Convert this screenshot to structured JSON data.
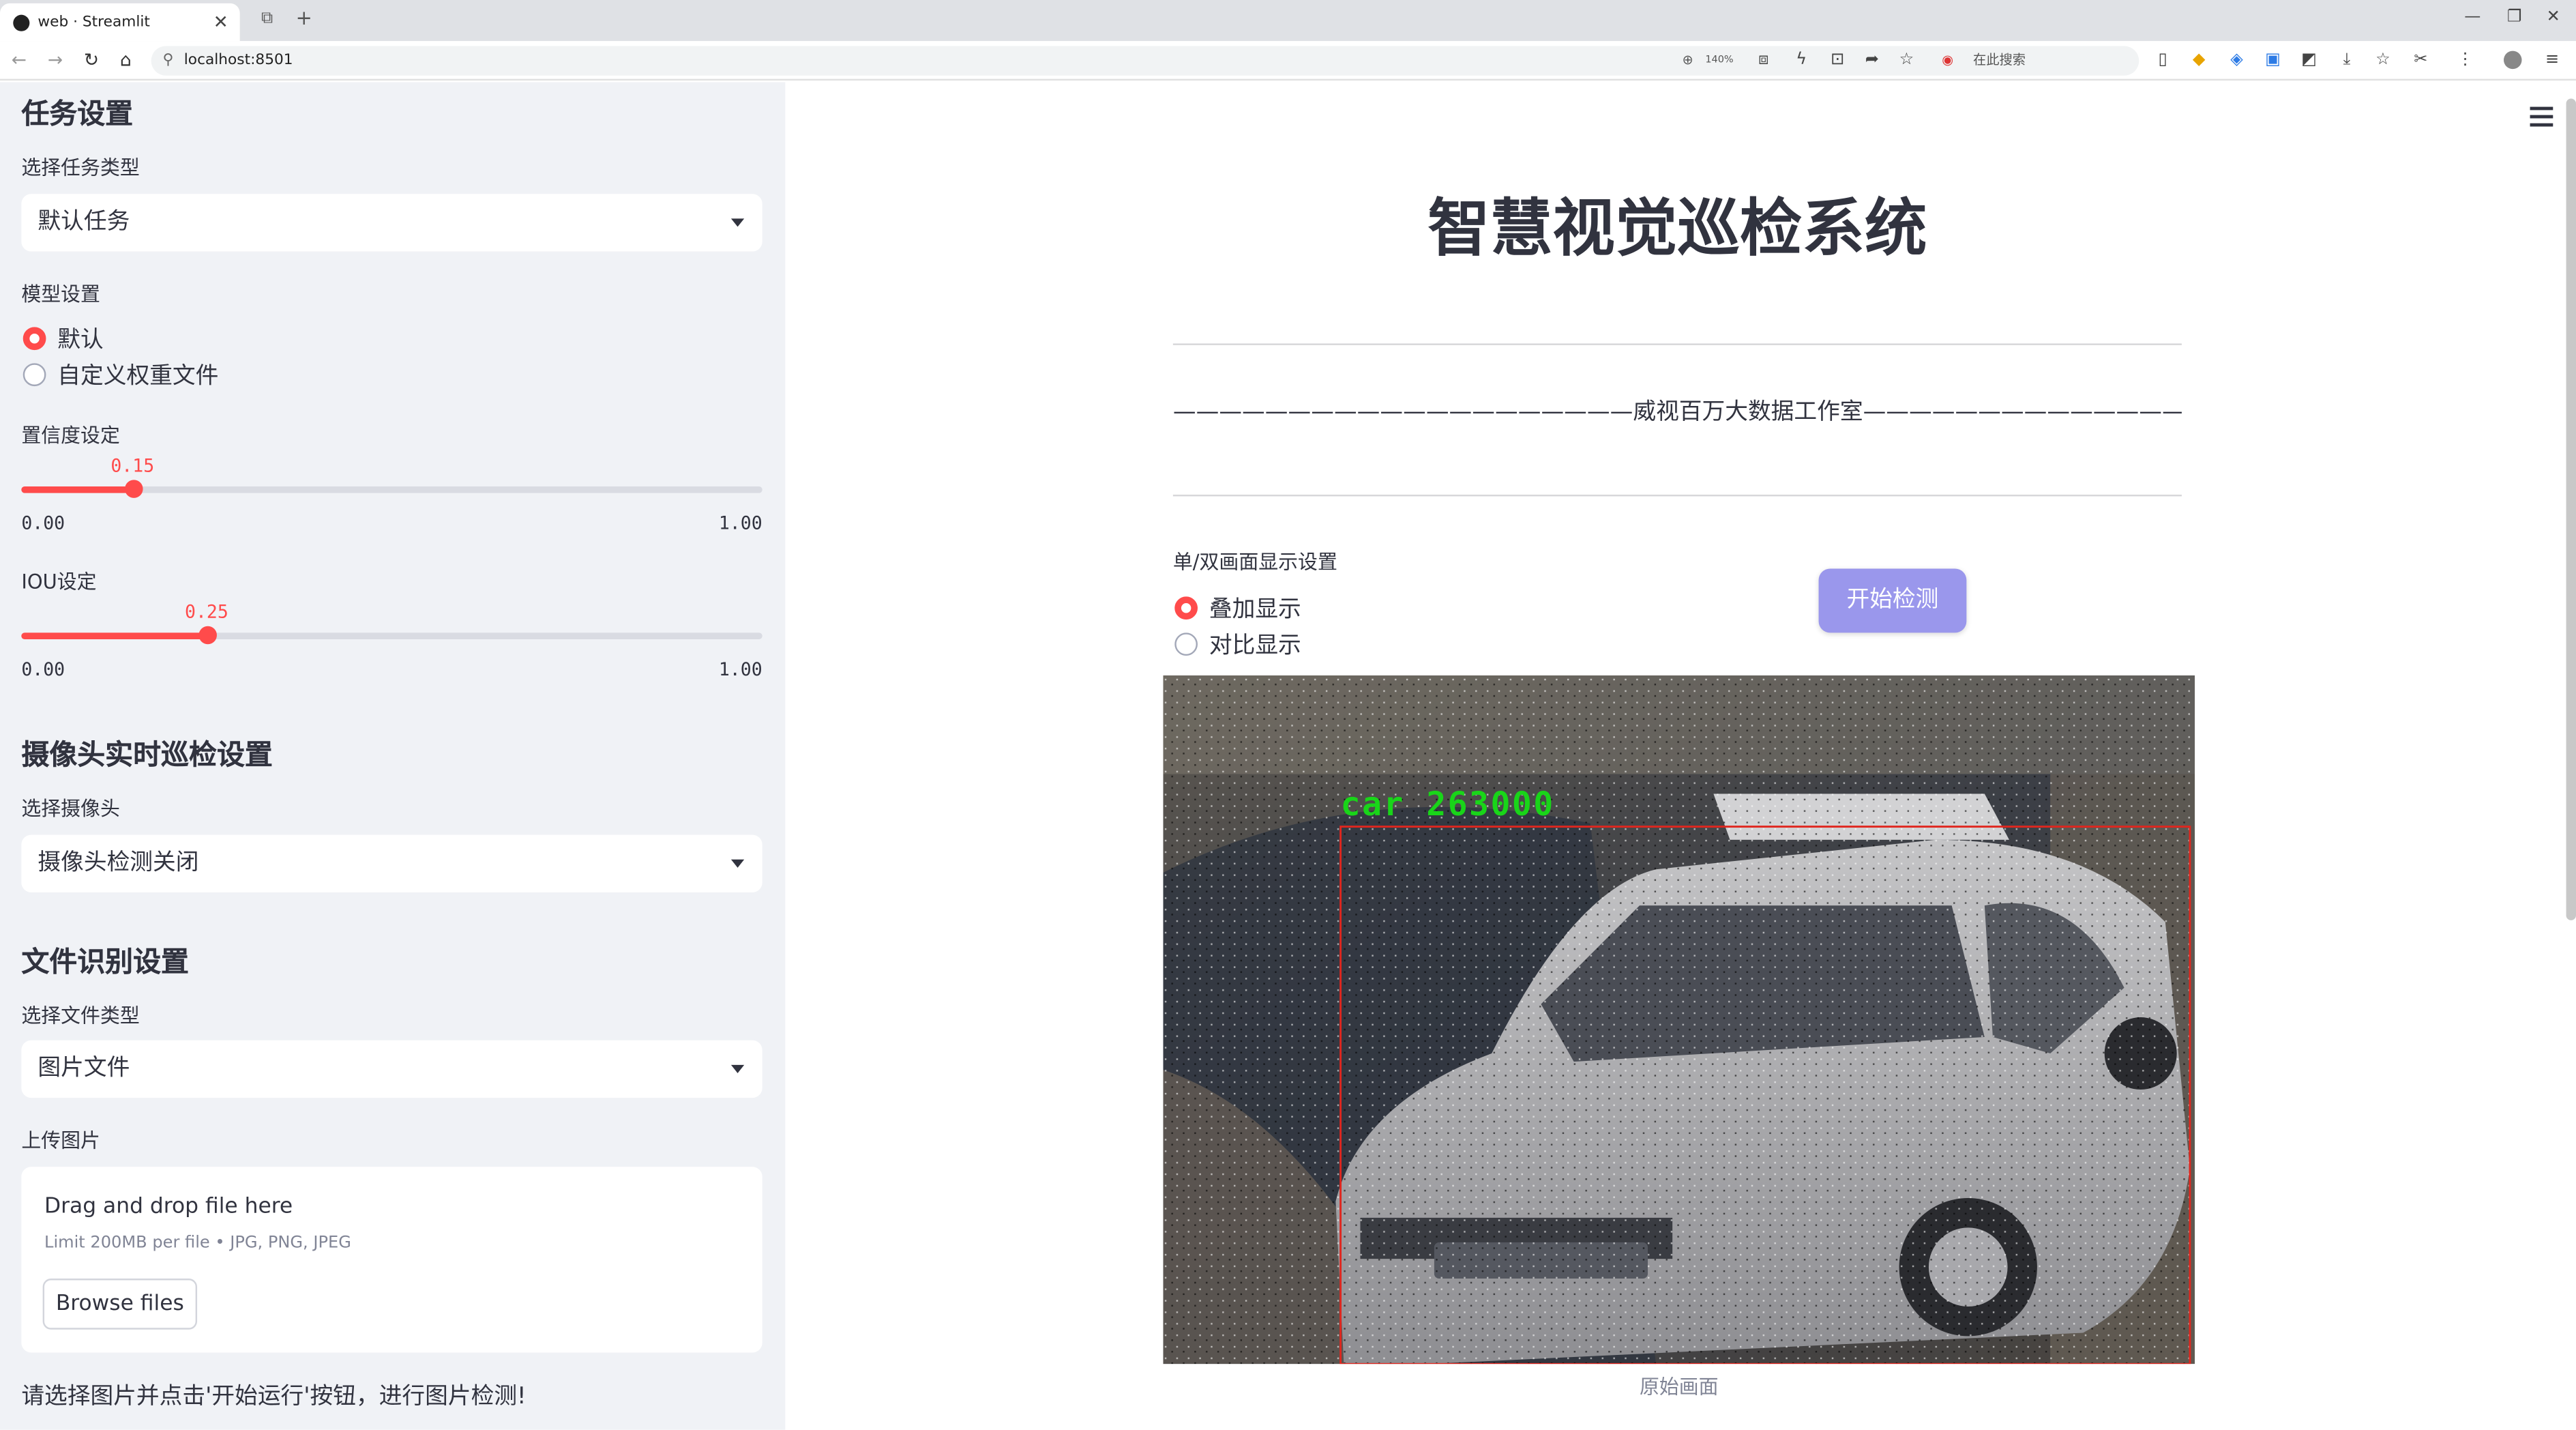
{
  "browser": {
    "tab_title": "web · Streamlit",
    "url": "localhost:8501",
    "zoom": "140%",
    "search_label": "在此搜索"
  },
  "sidebar": {
    "task_section_title": "任务设置",
    "task_type_label": "选择任务类型",
    "task_type_value": "默认任务",
    "model_label": "模型设置",
    "model_options": [
      "默认",
      "自定义权重文件"
    ],
    "model_selected": 0,
    "conf_label": "置信度设定",
    "conf_value": "0.15",
    "conf_fraction": 0.15,
    "conf_min": "0.00",
    "conf_max": "1.00",
    "iou_label": "IOU设定",
    "iou_value": "0.25",
    "iou_fraction": 0.25,
    "iou_min": "0.00",
    "iou_max": "1.00",
    "camera_section_title": "摄像头实时巡检设置",
    "camera_label": "选择摄像头",
    "camera_value": "摄像头检测关闭",
    "file_section_title": "文件识别设置",
    "file_type_label": "选择文件类型",
    "file_type_value": "图片文件",
    "upload_label": "上传图片",
    "upload_drag_text": "Drag and drop file here",
    "upload_limit_text": "Limit 200MB per file • JPG, PNG, JPEG",
    "browse_button": "Browse files",
    "hint_text": "请选择图片并点击'开始运行'按钮，进行图片检测!"
  },
  "main": {
    "title": "智慧视觉巡检系统",
    "studio_line": "————————————————————威视百万大数据工作室—————————————————————",
    "display_label": "单/双画面显示设置",
    "display_options": [
      "叠加显示",
      "对比显示"
    ],
    "display_selected": 0,
    "start_button": "开始检测",
    "detection_label": "car 263000",
    "image_caption": "原始画面"
  },
  "colors": {
    "accent": "#ff4b4b",
    "start_button": "#9a97ec",
    "sidebar_bg": "#f0f2f6",
    "detection_box": "#e0261e",
    "detection_text": "#19d519"
  }
}
